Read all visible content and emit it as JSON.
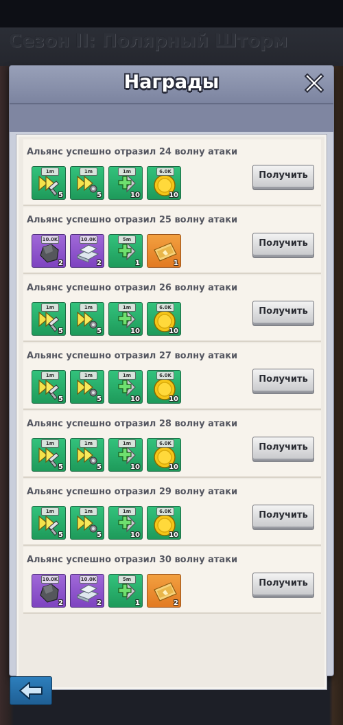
{
  "season_title": "Сезон II: Полярный Шторм",
  "modal": {
    "title": "Награды",
    "close_icon": "close-icon"
  },
  "claim_label": "Получить",
  "back_icon": "arrow-left-icon",
  "colors": {
    "green": "#27ad6b",
    "purple": "#8f55cc",
    "orange": "#ea8a2f",
    "header": "#8b92ad"
  },
  "rows": [
    {
      "title": "Альянс успешно отразил 24 волну атаки",
      "items": [
        {
          "icon": "speedup-build-icon",
          "color": "green",
          "tag": "1m",
          "qty": "5"
        },
        {
          "icon": "speedup-research-icon",
          "color": "green",
          "tag": "1m",
          "qty": "5"
        },
        {
          "icon": "speedup-heal-icon",
          "color": "green",
          "tag": "1m",
          "qty": "10"
        },
        {
          "icon": "gold-coin-icon",
          "color": "green",
          "tag": "6.0K",
          "qty": "10"
        }
      ]
    },
    {
      "title": "Альянс успешно отразил 25 волну атаки",
      "items": [
        {
          "icon": "coal-icon",
          "color": "purple",
          "tag": "10.0K",
          "qty": "2"
        },
        {
          "icon": "iron-icon",
          "color": "purple",
          "tag": "10.0K",
          "qty": "2"
        },
        {
          "icon": "speedup-heal-icon",
          "color": "green",
          "tag": "5m",
          "qty": "1"
        },
        {
          "icon": "chest-card-icon",
          "color": "orange",
          "tag": "",
          "qty": "1"
        }
      ]
    },
    {
      "title": "Альянс успешно отразил 26 волну атаки",
      "items": [
        {
          "icon": "speedup-build-icon",
          "color": "green",
          "tag": "1m",
          "qty": "5"
        },
        {
          "icon": "speedup-research-icon",
          "color": "green",
          "tag": "1m",
          "qty": "5"
        },
        {
          "icon": "speedup-heal-icon",
          "color": "green",
          "tag": "1m",
          "qty": "10"
        },
        {
          "icon": "gold-coin-icon",
          "color": "green",
          "tag": "6.0K",
          "qty": "10"
        }
      ]
    },
    {
      "title": "Альянс успешно отразил 27 волну атаки",
      "items": [
        {
          "icon": "speedup-build-icon",
          "color": "green",
          "tag": "1m",
          "qty": "5"
        },
        {
          "icon": "speedup-research-icon",
          "color": "green",
          "tag": "1m",
          "qty": "5"
        },
        {
          "icon": "speedup-heal-icon",
          "color": "green",
          "tag": "1m",
          "qty": "10"
        },
        {
          "icon": "gold-coin-icon",
          "color": "green",
          "tag": "6.0K",
          "qty": "10"
        }
      ]
    },
    {
      "title": "Альянс успешно отразил 28 волну атаки",
      "items": [
        {
          "icon": "speedup-build-icon",
          "color": "green",
          "tag": "1m",
          "qty": "5"
        },
        {
          "icon": "speedup-research-icon",
          "color": "green",
          "tag": "1m",
          "qty": "5"
        },
        {
          "icon": "speedup-heal-icon",
          "color": "green",
          "tag": "1m",
          "qty": "10"
        },
        {
          "icon": "gold-coin-icon",
          "color": "green",
          "tag": "6.0K",
          "qty": "10"
        }
      ]
    },
    {
      "title": "Альянс успешно отразил 29 волну атаки",
      "items": [
        {
          "icon": "speedup-build-icon",
          "color": "green",
          "tag": "1m",
          "qty": "5"
        },
        {
          "icon": "speedup-research-icon",
          "color": "green",
          "tag": "1m",
          "qty": "5"
        },
        {
          "icon": "speedup-heal-icon",
          "color": "green",
          "tag": "1m",
          "qty": "10"
        },
        {
          "icon": "gold-coin-icon",
          "color": "green",
          "tag": "6.0K",
          "qty": "10"
        }
      ]
    },
    {
      "title": "Альянс успешно отразил 30 волну атаки",
      "items": [
        {
          "icon": "coal-icon",
          "color": "purple",
          "tag": "10.0K",
          "qty": "2"
        },
        {
          "icon": "iron-icon",
          "color": "purple",
          "tag": "10.0K",
          "qty": "2"
        },
        {
          "icon": "speedup-heal-icon",
          "color": "green",
          "tag": "5m",
          "qty": "1"
        },
        {
          "icon": "chest-card-icon",
          "color": "orange",
          "tag": "",
          "qty": "2"
        }
      ]
    }
  ]
}
